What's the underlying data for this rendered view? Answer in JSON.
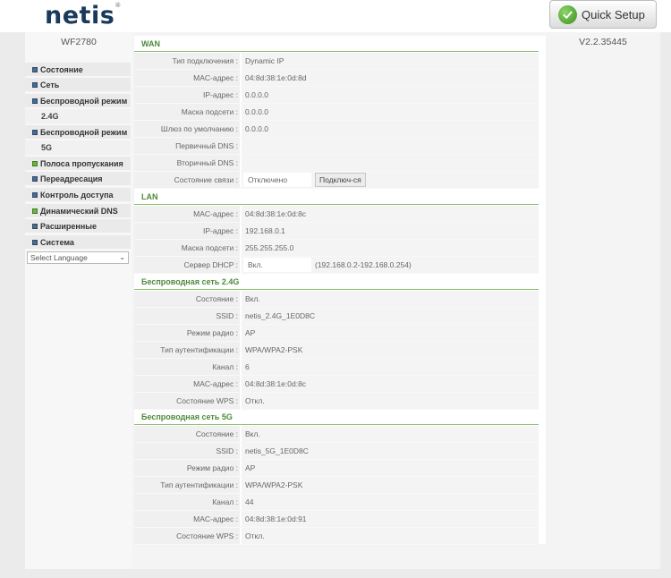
{
  "header": {
    "logo": "netis",
    "logo_tm": "®",
    "quick_setup_label": "Quick Setup"
  },
  "sidebar": {
    "model": "WF2780",
    "items": [
      {
        "label": "Состояние",
        "icon": "blue"
      },
      {
        "label": "Сеть",
        "icon": "pattern"
      },
      {
        "label": "Беспроводной режим",
        "icon": "pattern"
      },
      {
        "label": "2.4G",
        "icon": "none"
      },
      {
        "label": "Беспроводной режим",
        "icon": "pattern"
      },
      {
        "label": "5G",
        "icon": "none"
      },
      {
        "label": "Полоса пропускания",
        "icon": "green"
      },
      {
        "label": "Переадресация",
        "icon": "pattern"
      },
      {
        "label": "Контроль доступа",
        "icon": "pattern"
      },
      {
        "label": "Динамический DNS",
        "icon": "green"
      },
      {
        "label": "Расширенные",
        "icon": "pattern"
      },
      {
        "label": "Система",
        "icon": "pattern"
      }
    ],
    "language_select": "Select Language"
  },
  "version": "V2.2.35445",
  "wan": {
    "title": "WAN",
    "rows": [
      {
        "label": "Тип подключения :",
        "value": "Dynamic IP"
      },
      {
        "label": "MAC-адрес :",
        "value": "04:8d:38:1e:0d:8d"
      },
      {
        "label": "IP-адрес :",
        "value": "0.0.0.0"
      },
      {
        "label": "Маска подсети :",
        "value": "0.0.0.0"
      },
      {
        "label": "Шлюз по умолчанию :",
        "value": "0.0.0.0"
      },
      {
        "label": "Первичный DNS :",
        "value": ""
      },
      {
        "label": "Вторичный DNS :",
        "value": ""
      },
      {
        "label": "Состояние связи :",
        "value": "Отключено"
      }
    ],
    "reconnect_label": "Подключ-ся"
  },
  "lan": {
    "title": "LAN",
    "rows": [
      {
        "label": "MAC-адрес :",
        "value": "04:8d:38:1e:0d:8c"
      },
      {
        "label": "IP-адрес :",
        "value": "192.168.0.1"
      },
      {
        "label": "Маска подсети :",
        "value": "255.255.255.0"
      },
      {
        "label": "Сервер DHCP :",
        "value": "Вкл."
      }
    ],
    "dhcp_range": "(192.168.0.2-192.168.0.254)"
  },
  "wifi24": {
    "title": "Беспроводная сеть 2.4G",
    "rows": [
      {
        "label": "Состояние :",
        "value": "Вкл."
      },
      {
        "label": "SSID :",
        "value": "netis_2.4G_1E0D8C"
      },
      {
        "label": "Режим радио :",
        "value": "AP"
      },
      {
        "label": "Тип аутентификации :",
        "value": "WPA/WPA2-PSK"
      },
      {
        "label": "Канал :",
        "value": "6"
      },
      {
        "label": "MAC-адрес :",
        "value": "04:8d:38:1e:0d:8c"
      },
      {
        "label": "Состояние WPS :",
        "value": "Откл."
      }
    ]
  },
  "wifi5": {
    "title": "Беспроводная сеть 5G",
    "rows": [
      {
        "label": "Состояние :",
        "value": "Вкл."
      },
      {
        "label": "SSID :",
        "value": "netis_5G_1E0D8C"
      },
      {
        "label": "Режим радио :",
        "value": "AP"
      },
      {
        "label": "Тип аутентификации :",
        "value": "WPA/WPA2-PSK"
      },
      {
        "label": "Канал :",
        "value": "44"
      },
      {
        "label": "MAC-адрес :",
        "value": "04:8d:38:1e:0d:91"
      },
      {
        "label": "Состояние WPS :",
        "value": "Откл."
      }
    ]
  }
}
